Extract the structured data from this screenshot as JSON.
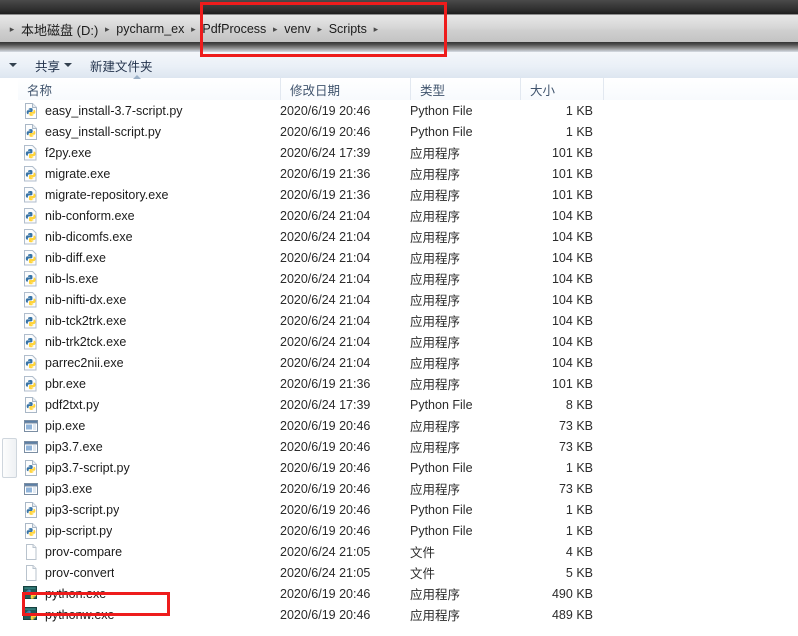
{
  "window": {
    "breadcrumb": {
      "name": "address-bar",
      "items": [
        {
          "label": "本地磁盘 (D:)",
          "cjk": true
        },
        {
          "label": "pycharm_ex",
          "cjk": false
        },
        {
          "label": "PdfProcess",
          "cjk": false
        },
        {
          "label": "venv",
          "cjk": false
        },
        {
          "label": "Scripts",
          "cjk": false
        }
      ],
      "separator": "▸"
    },
    "toolbar": {
      "organize_caret": "▼",
      "share_label": "共享",
      "share_caret": "▼",
      "new_folder_label": "新建文件夹"
    }
  },
  "columns": {
    "name": "名称",
    "date": "修改日期",
    "type": "类型",
    "size": "大小",
    "sort_indicator": "ascending"
  },
  "files": [
    {
      "name": "easy_install-3.7-script.py",
      "date": "2020/6/19 20:46",
      "type": "Python File",
      "size": "1 KB",
      "icon": "python-file-icon"
    },
    {
      "name": "easy_install-script.py",
      "date": "2020/6/19 20:46",
      "type": "Python File",
      "size": "1 KB",
      "icon": "python-file-icon"
    },
    {
      "name": "f2py.exe",
      "date": "2020/6/24 17:39",
      "type": "应用程序",
      "size": "101 KB",
      "icon": "python-exe-icon"
    },
    {
      "name": "migrate.exe",
      "date": "2020/6/19 21:36",
      "type": "应用程序",
      "size": "101 KB",
      "icon": "python-exe-icon"
    },
    {
      "name": "migrate-repository.exe",
      "date": "2020/6/19 21:36",
      "type": "应用程序",
      "size": "101 KB",
      "icon": "python-exe-icon"
    },
    {
      "name": "nib-conform.exe",
      "date": "2020/6/24 21:04",
      "type": "应用程序",
      "size": "104 KB",
      "icon": "python-exe-icon"
    },
    {
      "name": "nib-dicomfs.exe",
      "date": "2020/6/24 21:04",
      "type": "应用程序",
      "size": "104 KB",
      "icon": "python-exe-icon"
    },
    {
      "name": "nib-diff.exe",
      "date": "2020/6/24 21:04",
      "type": "应用程序",
      "size": "104 KB",
      "icon": "python-exe-icon"
    },
    {
      "name": "nib-ls.exe",
      "date": "2020/6/24 21:04",
      "type": "应用程序",
      "size": "104 KB",
      "icon": "python-exe-icon"
    },
    {
      "name": "nib-nifti-dx.exe",
      "date": "2020/6/24 21:04",
      "type": "应用程序",
      "size": "104 KB",
      "icon": "python-exe-icon"
    },
    {
      "name": "nib-tck2trk.exe",
      "date": "2020/6/24 21:04",
      "type": "应用程序",
      "size": "104 KB",
      "icon": "python-exe-icon"
    },
    {
      "name": "nib-trk2tck.exe",
      "date": "2020/6/24 21:04",
      "type": "应用程序",
      "size": "104 KB",
      "icon": "python-exe-icon"
    },
    {
      "name": "parrec2nii.exe",
      "date": "2020/6/24 21:04",
      "type": "应用程序",
      "size": "104 KB",
      "icon": "python-exe-icon"
    },
    {
      "name": "pbr.exe",
      "date": "2020/6/19 21:36",
      "type": "应用程序",
      "size": "101 KB",
      "icon": "python-exe-icon"
    },
    {
      "name": "pdf2txt.py",
      "date": "2020/6/24 17:39",
      "type": "Python File",
      "size": "8 KB",
      "icon": "python-file-icon"
    },
    {
      "name": "pip.exe",
      "date": "2020/6/19 20:46",
      "type": "应用程序",
      "size": "73 KB",
      "icon": "generic-exe-icon"
    },
    {
      "name": "pip3.7.exe",
      "date": "2020/6/19 20:46",
      "type": "应用程序",
      "size": "73 KB",
      "icon": "generic-exe-icon"
    },
    {
      "name": "pip3.7-script.py",
      "date": "2020/6/19 20:46",
      "type": "Python File",
      "size": "1 KB",
      "icon": "python-file-icon"
    },
    {
      "name": "pip3.exe",
      "date": "2020/6/19 20:46",
      "type": "应用程序",
      "size": "73 KB",
      "icon": "generic-exe-icon"
    },
    {
      "name": "pip3-script.py",
      "date": "2020/6/19 20:46",
      "type": "Python File",
      "size": "1 KB",
      "icon": "python-file-icon"
    },
    {
      "name": "pip-script.py",
      "date": "2020/6/19 20:46",
      "type": "Python File",
      "size": "1 KB",
      "icon": "python-file-icon"
    },
    {
      "name": "prov-compare",
      "date": "2020/6/24 21:05",
      "type": "文件",
      "size": "4 KB",
      "icon": "blank-file-icon"
    },
    {
      "name": "prov-convert",
      "date": "2020/6/24 21:05",
      "type": "文件",
      "size": "5 KB",
      "icon": "blank-file-icon"
    },
    {
      "name": "python.exe",
      "date": "2020/6/19 20:46",
      "type": "应用程序",
      "size": "490 KB",
      "icon": "python-console-icon"
    },
    {
      "name": "pythonw.exe",
      "date": "2020/6/19 20:46",
      "type": "应用程序",
      "size": "489 KB",
      "icon": "python-console-icon"
    }
  ],
  "annotations": [
    {
      "id": "anno-path",
      "name": "highlight-box-breadcrumb-path",
      "color": "#ee1c1c"
    },
    {
      "id": "anno-python",
      "name": "highlight-box-python-exe",
      "color": "#ee1c1c"
    }
  ]
}
